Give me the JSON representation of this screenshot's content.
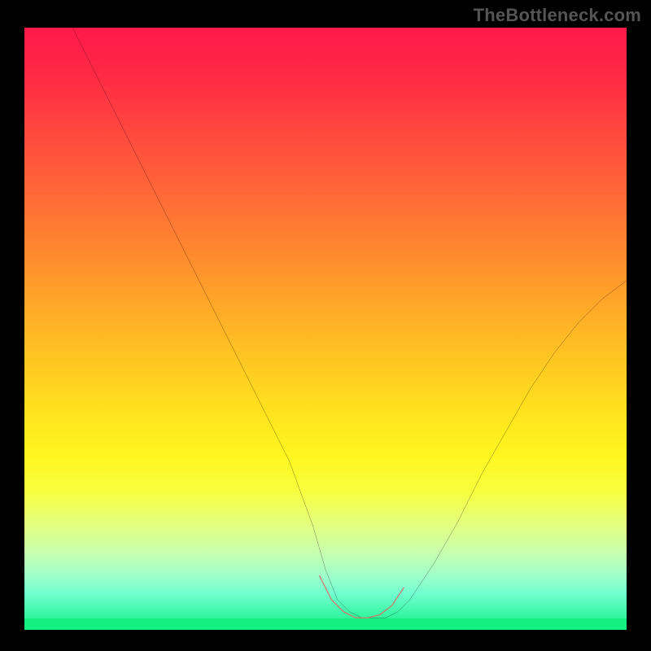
{
  "watermark": "TheBottleneck.com",
  "chart_data": {
    "type": "line",
    "title": "",
    "xlabel": "",
    "ylabel": "",
    "xlim": [
      0,
      100
    ],
    "ylim": [
      0,
      100
    ],
    "grid": false,
    "legend": false,
    "background_gradient": {
      "top_color": "#ff194a",
      "bottom_color": "#16f082",
      "stops": [
        {
          "pct": 0,
          "color": "#ff194a"
        },
        {
          "pct": 28,
          "color": "#ff6a36"
        },
        {
          "pct": 56,
          "color": "#ffc921"
        },
        {
          "pct": 77,
          "color": "#f7ff3e"
        },
        {
          "pct": 100,
          "color": "#16f082"
        }
      ]
    },
    "series": [
      {
        "name": "bottleneck-curve",
        "color": "#000000",
        "stroke_width": 1.6,
        "x": [
          8,
          12,
          16,
          20,
          24,
          28,
          32,
          36,
          40,
          44,
          48,
          50,
          52,
          54,
          56,
          58,
          60,
          62,
          64,
          68,
          72,
          76,
          80,
          84,
          88,
          92,
          96,
          100
        ],
        "y": [
          100,
          92,
          84,
          76,
          68,
          60,
          52,
          44,
          36,
          28,
          17,
          10,
          5,
          3,
          2,
          2,
          2,
          3,
          5,
          11,
          18,
          26,
          33,
          40,
          46,
          51,
          55,
          58
        ]
      },
      {
        "name": "flat-zone-highlight",
        "color": "#e06a66",
        "stroke_width": 7,
        "linecap": "round",
        "x": [
          49,
          51,
          53,
          55,
          57,
          59,
          61,
          63
        ],
        "y": [
          9,
          5,
          3,
          2,
          2,
          2.5,
          4,
          7
        ]
      }
    ],
    "annotations": []
  }
}
